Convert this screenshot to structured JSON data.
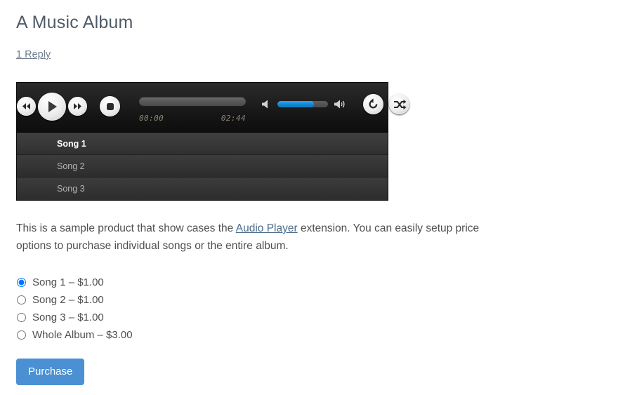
{
  "post": {
    "title": "A Music Album",
    "reply_link": "1 Reply"
  },
  "player": {
    "controls": {
      "rewind": "rewind-button",
      "play": "play-button",
      "forward": "fast-forward-button",
      "stop": "stop-button",
      "volume_down": "volume-down-icon",
      "volume_up": "volume-up-icon",
      "repeat": "repeat-button",
      "shuffle": "shuffle-button"
    },
    "time_current": "00:00",
    "time_total": "02:44",
    "progress_percent": 0,
    "volume_percent": 72,
    "colors": {
      "accent": "#1186d4",
      "player_bg": "#121212",
      "playlist_row": "#343434"
    },
    "playlist": [
      {
        "title": "Song 1",
        "active": true
      },
      {
        "title": "Song 2",
        "active": false
      },
      {
        "title": "Song 3",
        "active": false
      }
    ]
  },
  "description": {
    "part1": "This is a sample product that show cases the ",
    "link": "Audio Player",
    "part2": " extension. You can easily setup price options to purchase individual songs or the entire album."
  },
  "options": [
    {
      "label": "Song 1 – $1.00",
      "selected": true
    },
    {
      "label": "Song 2 – $1.00",
      "selected": false
    },
    {
      "label": "Song 3 – $1.00",
      "selected": false
    },
    {
      "label": "Whole Album – $3.00",
      "selected": false
    }
  ],
  "purchase": {
    "label": "Purchase",
    "color": "#4a90d2"
  }
}
